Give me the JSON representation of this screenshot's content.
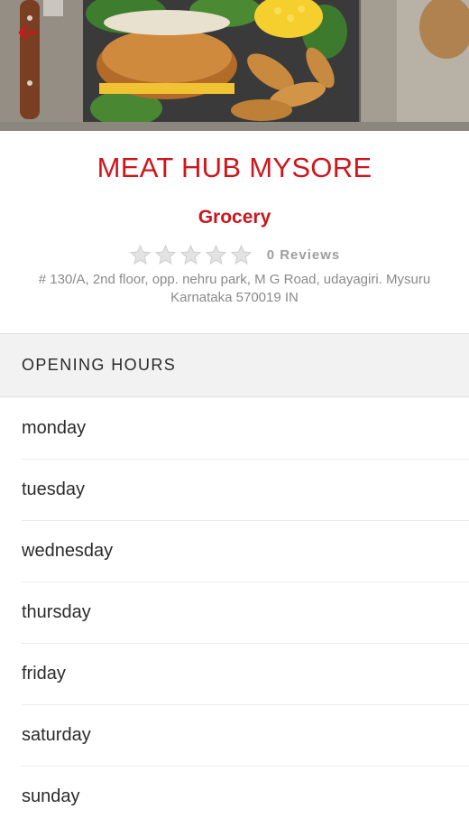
{
  "header": {
    "back_icon": "arrow-left-icon",
    "accent_color": "#d0161c"
  },
  "store": {
    "name": "MEAT HUB MYSORE",
    "category": "Grocery",
    "rating": 0,
    "rating_max": 5,
    "reviews_label": "0 Reviews",
    "address_line1": "# 130/A, 2nd floor, opp. nehru park, M G Road, udayagiri. Mysuru",
    "address_line2": "Karnataka 570019 IN"
  },
  "opening_hours": {
    "title": "OPENING HOURS",
    "days": [
      "monday",
      "tuesday",
      "wednesday",
      "thursday",
      "friday",
      "saturday",
      "sunday"
    ]
  }
}
